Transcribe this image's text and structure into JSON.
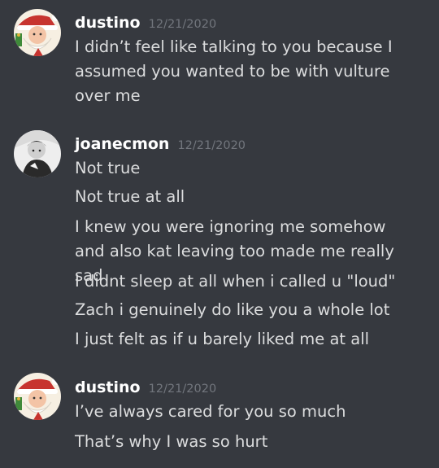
{
  "messages": [
    {
      "author": "dustino",
      "timestamp": "12/21/2020",
      "avatar_icon": "santa-avatar-icon",
      "lines": [
        "I didn’t feel like talking to you because I assumed you wanted to be with vulture over me"
      ]
    },
    {
      "author": "joanecmon",
      "timestamp": "12/21/2020",
      "avatar_icon": "bw-person-avatar-icon",
      "lines": [
        "Not true",
        "Not true at all",
        "I knew you were ignoring me somehow and also kat leaving too made me really sad",
        "I didnt sleep at all when i called u \"loud\"",
        "Zach i genuinely do like you a whole lot",
        "I just felt as if u barely liked me at all"
      ]
    },
    {
      "author": "dustino",
      "timestamp": "12/21/2020",
      "avatar_icon": "santa-avatar-icon",
      "lines": [
        "I’ve always cared for you so much",
        "That’s why I was so hurt"
      ]
    }
  ],
  "colors": {
    "background": "#36393f",
    "author": "#ffffff",
    "timestamp": "#72767d",
    "message_text": "#dcddde"
  }
}
